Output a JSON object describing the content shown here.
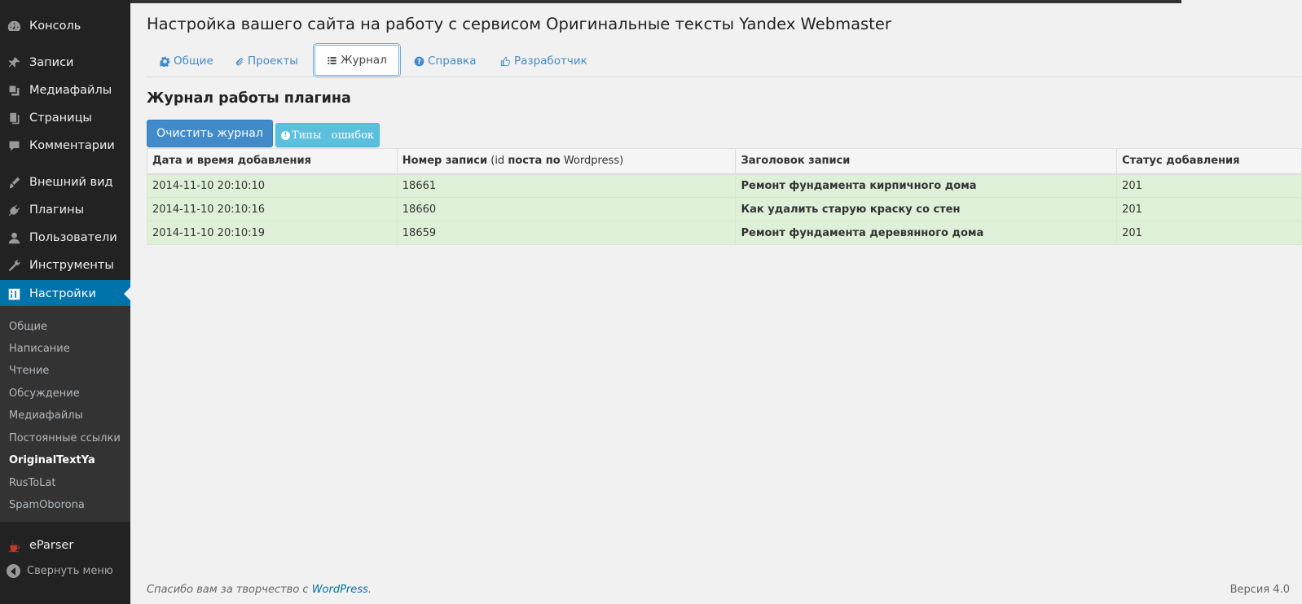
{
  "sidebar": {
    "menu": [
      {
        "label": "Консоль",
        "icon": "dashboard-icon"
      },
      {
        "label": "Записи",
        "icon": "pin-icon"
      },
      {
        "label": "Медиафайлы",
        "icon": "media-icon"
      },
      {
        "label": "Страницы",
        "icon": "pages-icon"
      },
      {
        "label": "Комментарии",
        "icon": "comment-icon"
      },
      {
        "label": "Внешний вид",
        "icon": "brush-icon"
      },
      {
        "label": "Плагины",
        "icon": "plugin-icon"
      },
      {
        "label": "Пользователи",
        "icon": "user-icon"
      },
      {
        "label": "Инструменты",
        "icon": "wrench-icon"
      },
      {
        "label": "Настройки",
        "icon": "settings-icon"
      }
    ],
    "submenu": [
      "Общие",
      "Написание",
      "Чтение",
      "Обсуждение",
      "Медиафайлы",
      "Постоянные ссылки",
      "OriginalTextYa",
      "RusToLat",
      "SpamOborona"
    ],
    "current_submenu": "OriginalTextYa",
    "eparser": {
      "label": "eParser",
      "icon": "coffee-icon"
    },
    "collapse_label": "Свернуть меню"
  },
  "page": {
    "title": "Настройка вашего сайта на работу с сервисом Оригинальные тексты Yandex Webmaster"
  },
  "tabs": [
    {
      "label": "Общие",
      "icon": "gear-icon"
    },
    {
      "label": "Проекты",
      "icon": "paperclip-icon"
    },
    {
      "label": "Журнал",
      "icon": "list-icon",
      "active": true
    },
    {
      "label": "Справка",
      "icon": "question-icon"
    },
    {
      "label": "Разработчик",
      "icon": "thumbs-up-icon"
    }
  ],
  "section": {
    "title": "Журнал работы плагина",
    "clear_button": "Очистить журнал",
    "types_button": "Типы   ошибок"
  },
  "table": {
    "headers": {
      "date": "Дата и время добавления",
      "number_bold": "Номер записи",
      "number_paren_open": " (id ",
      "number_bold2": "поста по",
      "number_paren_close": " Wordpress)",
      "title": "Заголовок записи",
      "status": "Статус добавления"
    },
    "rows": [
      {
        "date": "2014-11-10 20:10:10",
        "id": "18661",
        "title": "Ремонт фундамента кирпичного дома",
        "status": "201"
      },
      {
        "date": "2014-11-10 20:10:16",
        "id": "18660",
        "title": "Как удалить старую краску со стен",
        "status": "201"
      },
      {
        "date": "2014-11-10 20:10:19",
        "id": "18659",
        "title": "Ремонт фундамента деревянного дома",
        "status": "201"
      }
    ]
  },
  "footer": {
    "thanks_prefix": "Спасибо вам за творчество с ",
    "thanks_link": "WordPress",
    "thanks_suffix": ".",
    "version": "Версия 4.0"
  },
  "colors": {
    "sidebar_bg": "#222222",
    "active_menu": "#0073aa",
    "primary_btn": "#428bca",
    "info_btn": "#5bc0de",
    "row_success": "#dff0d8"
  }
}
